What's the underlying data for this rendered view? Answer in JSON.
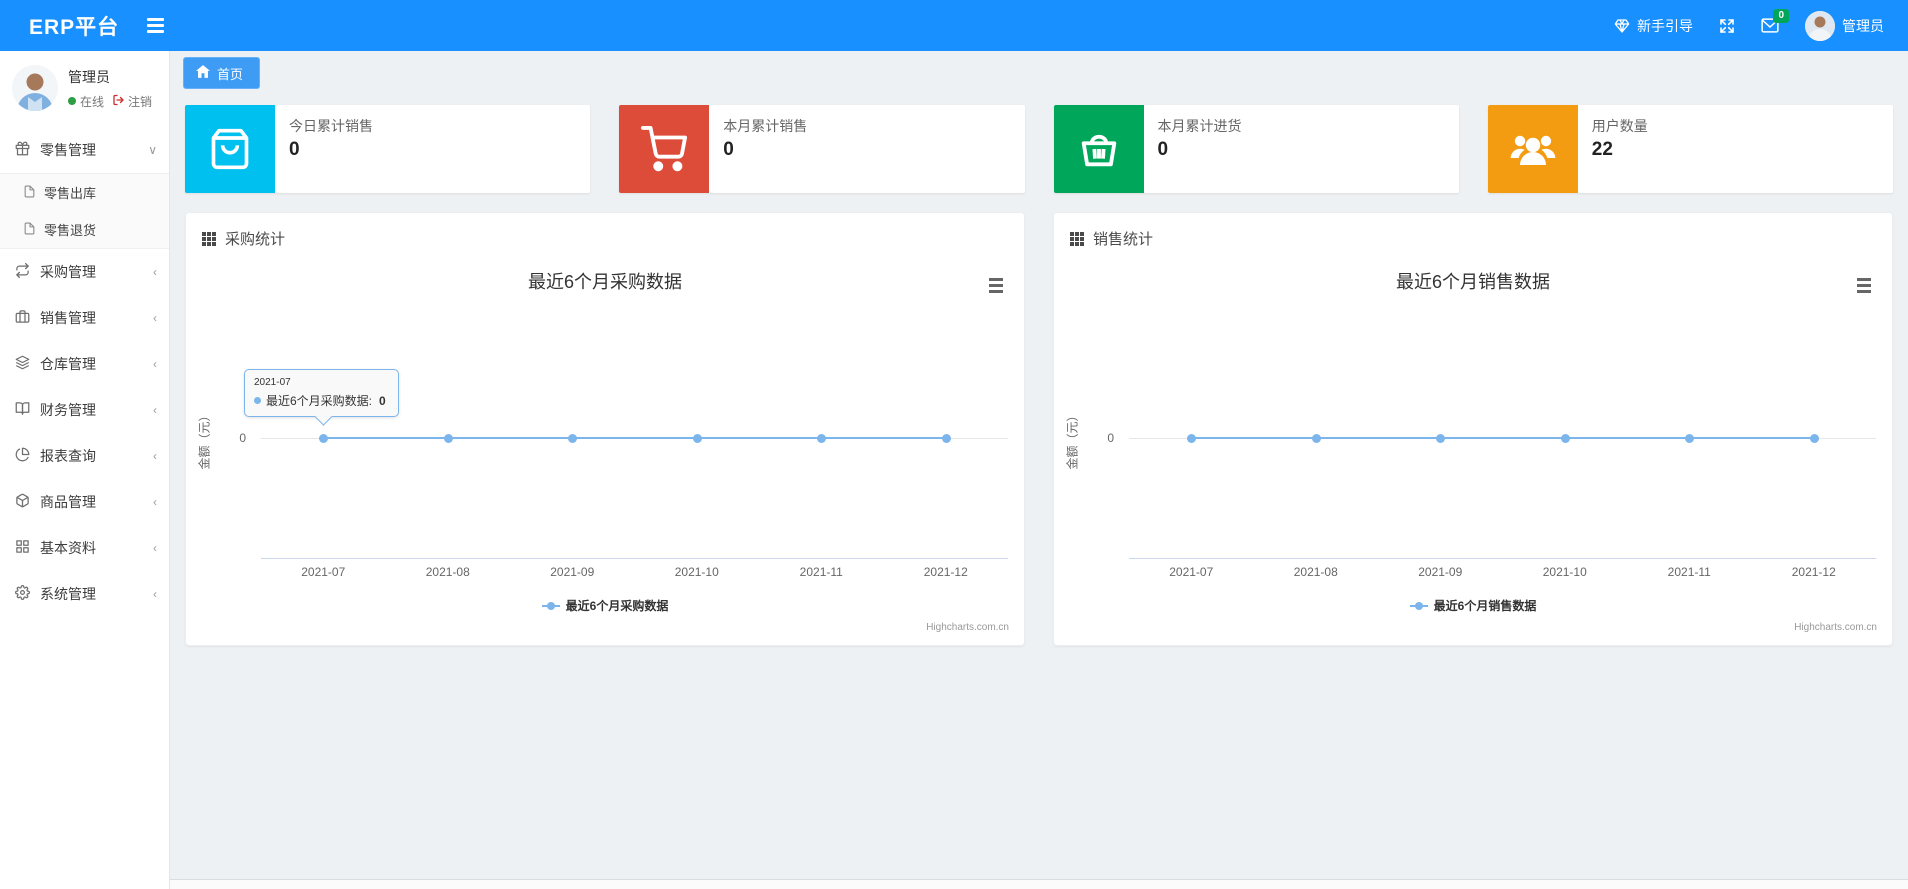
{
  "header": {
    "brand": "ERP平台",
    "guide_label": "新手引导",
    "badge_count": "0",
    "username": "管理员",
    "navbar_color": "#1890ff"
  },
  "sidebar": {
    "profile": {
      "name": "管理员",
      "status": "在线",
      "logout": "注销",
      "status_color": "#2e9e44"
    },
    "menu": [
      {
        "label": "零售管理",
        "icon": "gift-icon",
        "state": "expanded"
      },
      {
        "label": "零售出库",
        "icon": "file-icon"
      },
      {
        "label": "零售退货",
        "icon": "file-icon"
      },
      {
        "label": "采购管理",
        "icon": "repeat-icon"
      },
      {
        "label": "销售管理",
        "icon": "briefcase-icon"
      },
      {
        "label": "仓库管理",
        "icon": "layers-icon"
      },
      {
        "label": "财务管理",
        "icon": "book-icon"
      },
      {
        "label": "报表查询",
        "icon": "pie-chart-icon"
      },
      {
        "label": "商品管理",
        "icon": "box-icon"
      },
      {
        "label": "基本资料",
        "icon": "grid-icon"
      },
      {
        "label": "系统管理",
        "icon": "gear-icon"
      }
    ],
    "chevron_expanded": "∨",
    "chevron_collapsed": "‹"
  },
  "tabs": {
    "home": "首页"
  },
  "cards": [
    {
      "title": "今日累计销售",
      "value": "0",
      "color": "#00c0ef",
      "icon": "shopping-bag-icon"
    },
    {
      "title": "本月累计销售",
      "value": "0",
      "color": "#dd4b39",
      "icon": "shopping-cart-icon"
    },
    {
      "title": "本月累计进货",
      "value": "0",
      "color": "#00a65a",
      "icon": "shopping-basket-icon"
    },
    {
      "title": "用户数量",
      "value": "22",
      "color": "#f39c12",
      "icon": "users-icon"
    }
  ],
  "panels": [
    {
      "title": "采购统计"
    },
    {
      "title": "销售统计"
    }
  ],
  "chart_data": [
    {
      "type": "line",
      "title": "最近6个月采购数据",
      "categories": [
        "2021-07",
        "2021-08",
        "2021-09",
        "2021-10",
        "2021-11",
        "2021-12"
      ],
      "series": [
        {
          "name": "最近6个月采购数据",
          "values": [
            0,
            0,
            0,
            0,
            0,
            0
          ]
        }
      ],
      "ylabel": "金额（元）",
      "ytick": "0",
      "ylim": [
        0,
        0
      ],
      "grid": false,
      "legend": "最近6个月采购数据",
      "legend_position": "bottom",
      "line_color": "#7cb5ec",
      "credit": "Highcharts.com.cn",
      "tooltip": {
        "header": "2021-07",
        "series": "最近6个月采购数据:",
        "value": "0"
      }
    },
    {
      "type": "line",
      "title": "最近6个月销售数据",
      "categories": [
        "2021-07",
        "2021-08",
        "2021-09",
        "2021-10",
        "2021-11",
        "2021-12"
      ],
      "series": [
        {
          "name": "最近6个月销售数据",
          "values": [
            0,
            0,
            0,
            0,
            0,
            0
          ]
        }
      ],
      "ylabel": "金额（元）",
      "ytick": "0",
      "ylim": [
        0,
        0
      ],
      "grid": false,
      "legend": "最近6个月销售数据",
      "legend_position": "bottom",
      "line_color": "#7cb5ec",
      "credit": "Highcharts.com.cn"
    }
  ]
}
